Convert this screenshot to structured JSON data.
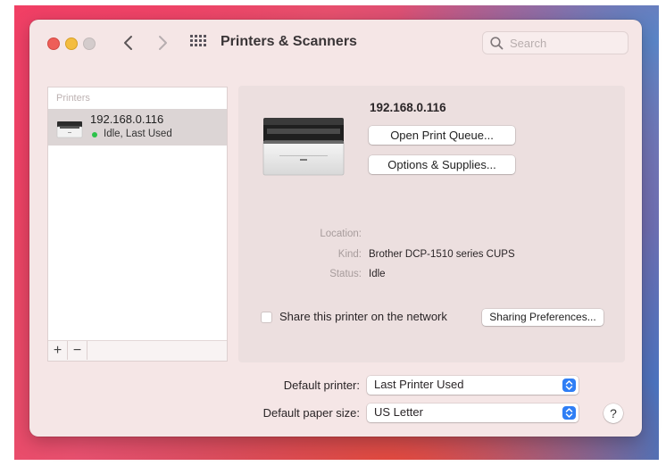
{
  "window": {
    "title": "Printers & Scanners",
    "search_placeholder": "Search"
  },
  "sidebar": {
    "header": "Printers",
    "printers": [
      {
        "name": "192.168.0.116",
        "status": "Idle, Last Used",
        "status_color": "#2cc24a"
      }
    ],
    "add_label": "+",
    "remove_label": "−"
  },
  "detail": {
    "device_name": "192.168.0.116",
    "open_queue_label": "Open Print Queue...",
    "options_label": "Options & Supplies...",
    "location_label": "Location:",
    "location_value": "",
    "kind_label": "Kind:",
    "kind_value": "Brother DCP-1510 series CUPS",
    "status_label": "Status:",
    "status_value": "Idle",
    "share_label": "Share this printer on the network",
    "share_checked": false,
    "sharing_prefs_label": "Sharing Preferences..."
  },
  "defaults": {
    "printer_label": "Default printer:",
    "printer_value": "Last Printer Used",
    "paper_label": "Default paper size:",
    "paper_value": "US Letter"
  },
  "help_label": "?",
  "colors": {
    "accent": "#2f7ef5",
    "window_bg": "#f5e6e6",
    "panel_bg": "#ecdfdf",
    "selection": "#dcd5d5"
  },
  "icons": [
    "back-chevron-icon",
    "forward-chevron-icon",
    "show-all-grid-icon",
    "search-icon",
    "printer-icon",
    "popup-arrows-icon"
  ]
}
